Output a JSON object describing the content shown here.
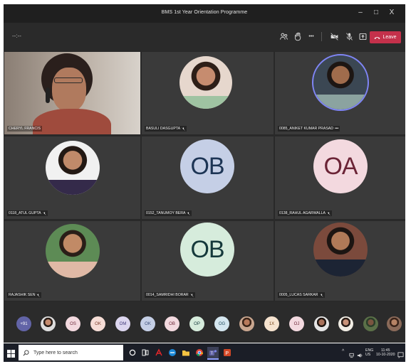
{
  "window": {
    "title": "BMS 1st Year Orientation Programme",
    "minimize": "–",
    "maximize": "□",
    "close": "X"
  },
  "toolbar": {
    "timer": "--:--",
    "leave_label": "Leave",
    "more_label": "•••"
  },
  "tiles": [
    {
      "name": "CHERYL FRANCIS",
      "kind": "video"
    },
    {
      "name": "BASULI DASGUPTA",
      "kind": "photo"
    },
    {
      "name": "0085_ANIKET KUMAR PRASAD",
      "kind": "photo"
    },
    {
      "name": "0118_ATUL GUPTA",
      "kind": "photo"
    },
    {
      "name": "0152_TANUMOY BERA",
      "kind": "initials",
      "initials": "OB"
    },
    {
      "name": "0138_RAHUL AGARWALLA",
      "kind": "initials",
      "initials": "OA"
    },
    {
      "name": "RAJASHIK SEN",
      "kind": "photo"
    },
    {
      "name": "0014_SAMRIDHI BORAR",
      "kind": "initials",
      "initials": "OB"
    },
    {
      "name": "0005_LUCAS SARKAR",
      "kind": "photo"
    }
  ],
  "strip": {
    "overflow": "+91",
    "items": [
      "",
      "OS",
      "OK",
      "OM",
      "OK",
      "OB",
      "OP",
      "OG",
      "",
      "1X",
      "OJ",
      "",
      "",
      "",
      ""
    ]
  },
  "taskbar": {
    "search_placeholder": "Type here to search",
    "lang_top": "ENG",
    "lang_bottom": "US",
    "time": "11:45",
    "date": "10-10-2020"
  },
  "colors": {
    "leave": "#c4314b",
    "initials_blue": "#c5cfe6",
    "initials_green": "#d6ecdc",
    "initials_pink": "#f3d9df"
  }
}
